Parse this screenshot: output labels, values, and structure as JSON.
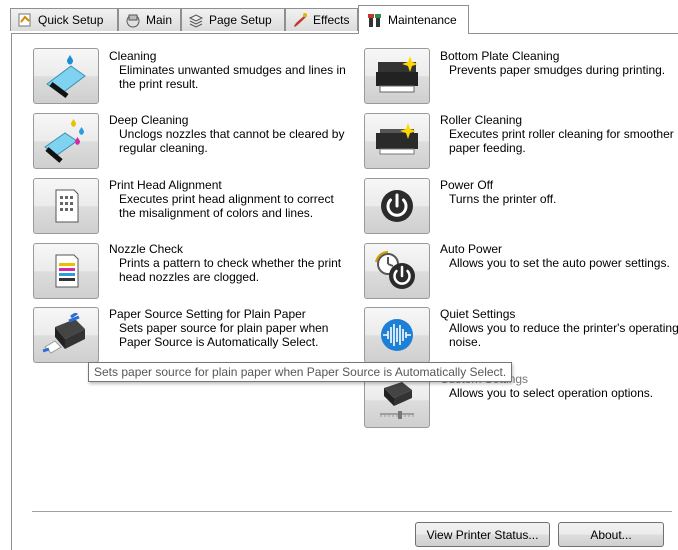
{
  "tabs": [
    {
      "label": "Quick Setup",
      "icon": "quick-setup-icon"
    },
    {
      "label": "Main",
      "icon": "main-icon"
    },
    {
      "label": "Page Setup",
      "icon": "page-setup-icon"
    },
    {
      "label": "Effects",
      "icon": "effects-icon"
    },
    {
      "label": "Maintenance",
      "icon": "maintenance-icon",
      "active": true
    }
  ],
  "left_items": [
    {
      "title": "Cleaning",
      "desc": "Eliminates unwanted smudges and lines in the print result.",
      "icon": "cleaning-icon"
    },
    {
      "title": "Deep Cleaning",
      "desc": "Unclogs nozzles that cannot be cleared by regular cleaning.",
      "icon": "deep-cleaning-icon"
    },
    {
      "title": "Print Head Alignment",
      "desc": "Executes print head alignment to correct the misalignment of colors and lines.",
      "icon": "print-head-alignment-icon"
    },
    {
      "title": "Nozzle Check",
      "desc": "Prints a pattern to check whether the print head nozzles are clogged.",
      "icon": "nozzle-check-icon"
    },
    {
      "title": "Paper Source Setting for Plain Paper",
      "desc": "Sets paper source for plain paper when Paper Source is Automatically Select.",
      "icon": "paper-source-icon"
    }
  ],
  "right_items": [
    {
      "title": "Bottom Plate Cleaning",
      "desc": "Prevents paper smudges during printing.",
      "icon": "bottom-plate-icon"
    },
    {
      "title": "Roller Cleaning",
      "desc": "Executes print roller cleaning for smoother paper feeding.",
      "icon": "roller-cleaning-icon"
    },
    {
      "title": "Power Off",
      "desc": "Turns the printer off.",
      "icon": "power-off-icon"
    },
    {
      "title": "Auto Power",
      "desc": "Allows you to set the auto power settings.",
      "icon": "auto-power-icon"
    },
    {
      "title": "Quiet Settings",
      "desc": "Allows you to reduce the printer's operating noise.",
      "icon": "quiet-settings-icon"
    },
    {
      "title": "Custom Settings",
      "desc": "Allows you to select operation options.",
      "icon": "custom-settings-icon"
    }
  ],
  "tooltip": "Sets paper source for plain paper when Paper Source is Automatically Select.",
  "buttons": {
    "view_status": "View Printer Status...",
    "about": "About..."
  },
  "colors": {
    "tab_border": "#8e8f8f",
    "power_blue": "#1f5fa8",
    "quiet_blue": "#1e7fd6"
  }
}
